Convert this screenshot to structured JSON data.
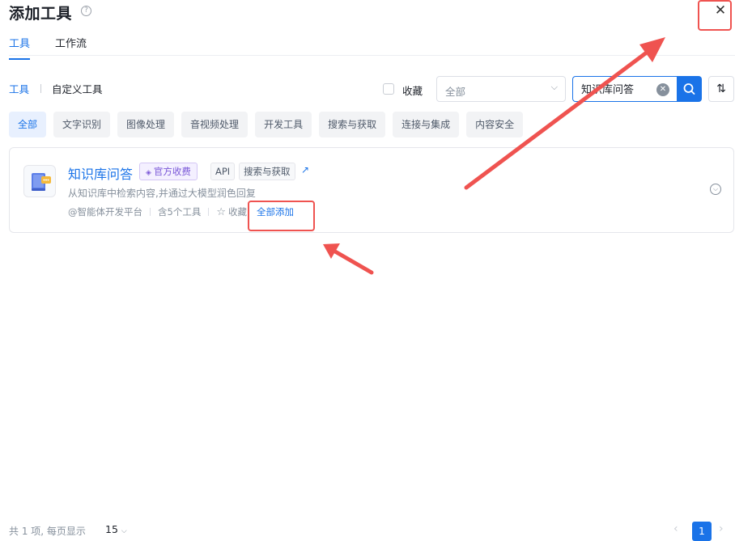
{
  "header": {
    "title": "添加工具",
    "help_icon": "question-circle-icon",
    "close_icon": "close-icon"
  },
  "tabs": [
    {
      "label": "工具",
      "active": true
    },
    {
      "label": "工作流",
      "active": false
    }
  ],
  "subtabs": [
    {
      "label": "工具",
      "active": true
    },
    {
      "label": "自定义工具",
      "active": false
    }
  ],
  "filters": {
    "favorite_label": "收藏",
    "favorite_checked": false,
    "select_value": "全部",
    "search_value": "知识库问答",
    "search_icon": "search-icon",
    "sort_icon": "sort-icon"
  },
  "categories": [
    {
      "label": "全部",
      "active": true
    },
    {
      "label": "文字识别",
      "active": false
    },
    {
      "label": "图像处理",
      "active": false
    },
    {
      "label": "音视频处理",
      "active": false
    },
    {
      "label": "开发工具",
      "active": false
    },
    {
      "label": "搜索与获取",
      "active": false
    },
    {
      "label": "连接与集成",
      "active": false
    },
    {
      "label": "内容安全",
      "active": false
    }
  ],
  "tool": {
    "name": "知识库问答",
    "icon": "knowledge-book-icon",
    "badge_official": "官方收费",
    "badge_api": "API",
    "badge_category": "搜索与获取",
    "link_icon": "external-link-icon",
    "description": "从知识库中检索内容,并通过大模型润色回复",
    "author": "@智能体开发平台",
    "tool_count": "含5个工具",
    "favorite_label": "收藏",
    "add_all_label": "全部添加",
    "expand_icon": "chevron-down-circle-icon"
  },
  "pagination": {
    "summary": "共 1 项,  每页显示",
    "page_size": "15",
    "current_page": "1"
  },
  "colors": {
    "primary": "#1a73e8",
    "annotation_red": "#ef5350",
    "official_badge": "#7b59d8"
  }
}
